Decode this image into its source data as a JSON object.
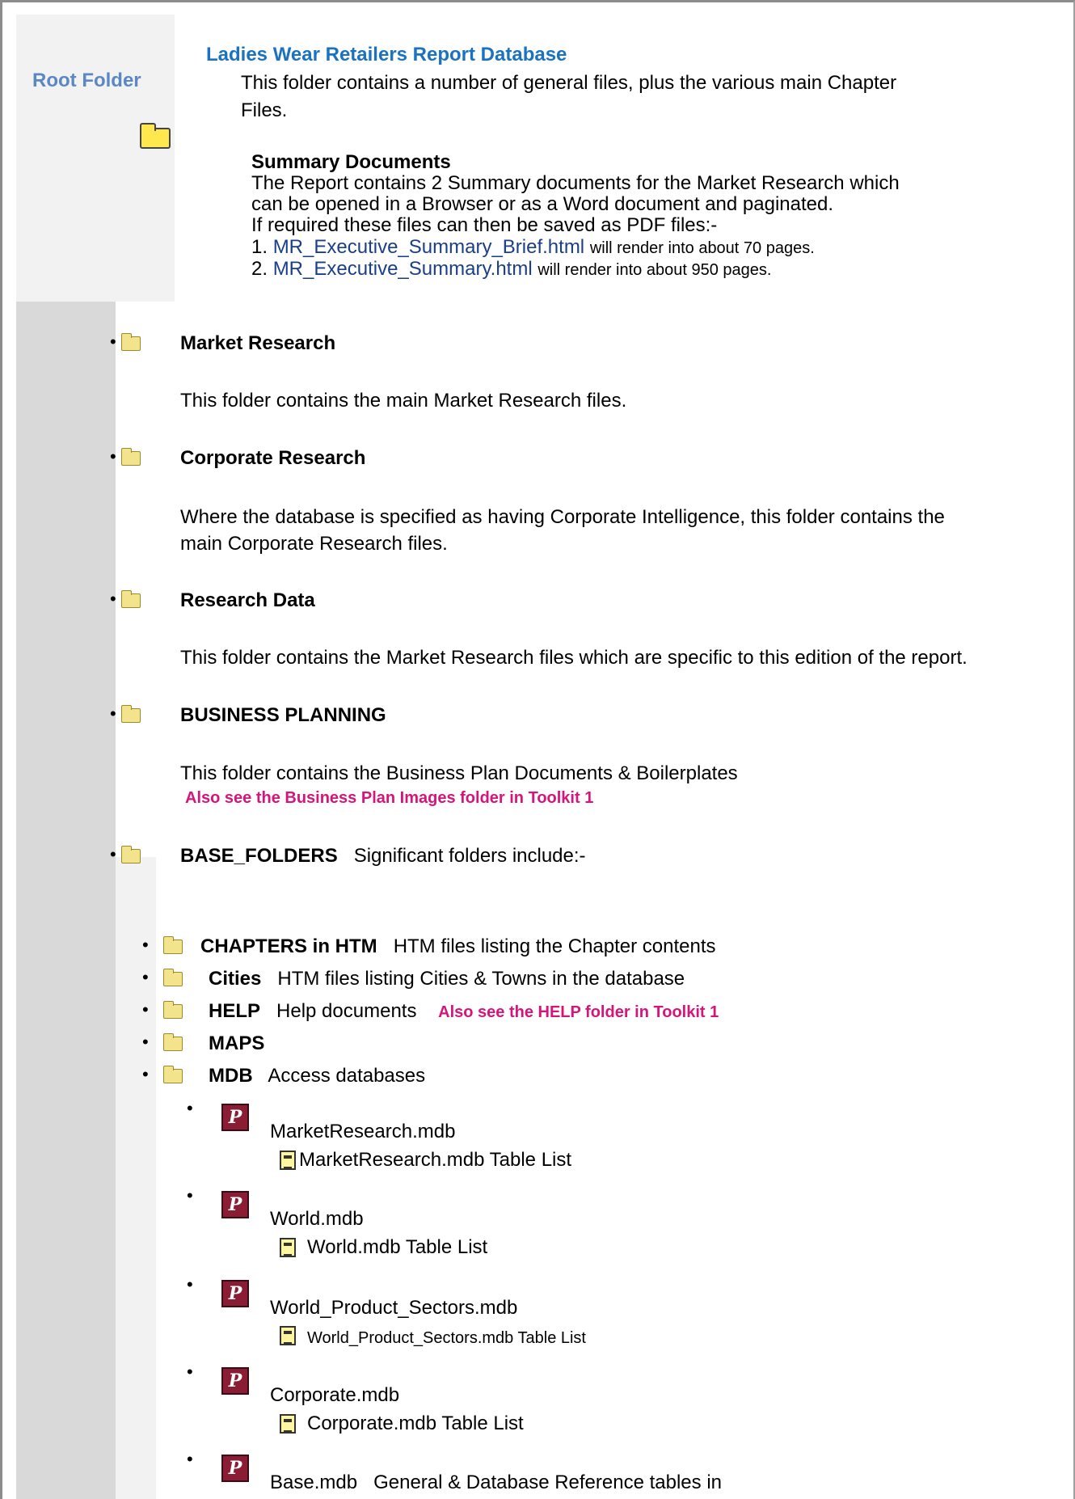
{
  "root": {
    "label": "Root Folder",
    "title": "Ladies Wear Retailers Report Database",
    "desc_line1": "This folder contains a number of general files, plus the various main Chapter",
    "desc_line2": "Files.",
    "summary_heading": "Summary Documents",
    "summary_line1": "The Report contains 2 Summary documents for the Market Research which",
    "summary_line2": "can be opened in a Browser or as a Word document and paginated.",
    "summary_line3": "If required these files can then be saved as PDF files:-",
    "doc1_num": "1.",
    "doc1_link": "MR_Executive_Summary_Brief.html",
    "doc1_note": "will render into about 70 pages.",
    "doc2_num": "2.",
    "doc2_link": "MR_Executive_Summary.html",
    "doc2_note": "will render into about 950 pages."
  },
  "folders": {
    "market": {
      "name": "Market Research",
      "desc": "This folder contains the main Market Research files."
    },
    "corporate": {
      "name": "Corporate Research",
      "desc1": "Where the database is specified as having Corporate Intelligence, this folder contains the",
      "desc2": "main Corporate Research files."
    },
    "research_data": {
      "name": "Research Data",
      "desc": "This folder contains the Market Research files which are specific to this edition of the report."
    },
    "business": {
      "name": "BUSINESS PLANNING",
      "desc": "This folder contains the Business Plan Documents & Boilerplates",
      "note": "Also see the Business Plan Images folder in Toolkit 1"
    },
    "base": {
      "name": "BASE_FOLDERS",
      "desc": "Significant folders include:-"
    }
  },
  "subfolders": {
    "chapters": {
      "name": "CHAPTERS in HTM",
      "desc": "HTM files listing the Chapter contents"
    },
    "cities": {
      "name": "Cities",
      "desc": "HTM files listing Cities & Towns in the database"
    },
    "help": {
      "name": "HELP",
      "desc": "Help documents",
      "note": "Also see the HELP folder in Toolkit 1"
    },
    "maps": {
      "name": "MAPS"
    },
    "mdb": {
      "name": "MDB",
      "desc": "Access databases"
    }
  },
  "databases": {
    "market": {
      "file": "MarketResearch.mdb",
      "table_list": "MarketResearch.mdb Table List"
    },
    "world": {
      "file": "World.mdb",
      "table_list": "World.mdb Table List"
    },
    "sectors": {
      "file": "World_Product_Sectors.mdb",
      "table_list": "World_Product_Sectors.mdb Table List"
    },
    "corporate": {
      "file": "Corporate.mdb",
      "table_list": "Corporate.mdb Table List"
    },
    "base": {
      "file": "Base.mdb",
      "desc": "General & Database Reference tables in"
    }
  },
  "glyphs": {
    "bullet": "•",
    "access_letter": "P"
  }
}
